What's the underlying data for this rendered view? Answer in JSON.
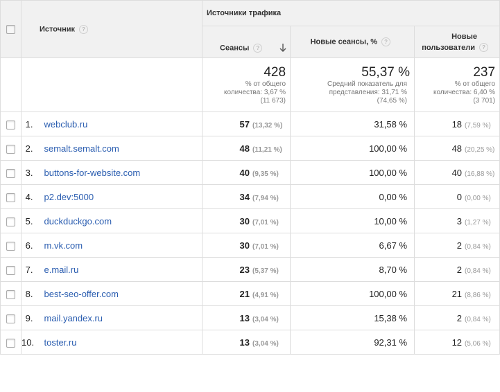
{
  "header": {
    "source_label": "Источник",
    "group_label": "Источники трафика",
    "sessions_label": "Сеансы",
    "new_sessions_label": "Новые сеансы, %",
    "new_users_label_line1": "Новые",
    "new_users_label_line2": "пользователи"
  },
  "summary": {
    "sessions": {
      "value": "428",
      "line1": "% от общего",
      "line2": "количества: 3,67 %",
      "line3": "(11 673)"
    },
    "new_sessions": {
      "value": "55,37 %",
      "line1": "Средний показатель для",
      "line2": "представления: 31,71 %",
      "line3": "(74,65 %)"
    },
    "new_users": {
      "value": "237",
      "line1": "% от общего",
      "line2": "количества: 6,40 %",
      "line3": "(3 701)"
    }
  },
  "rows": [
    {
      "idx": "1.",
      "source": "webclub.ru",
      "sessions": "57",
      "sessions_pct": "(13,32 %)",
      "new_sessions": "31,58 %",
      "new_users": "18",
      "new_users_pct": "(7,59 %)"
    },
    {
      "idx": "2.",
      "source": "semalt.semalt.com",
      "sessions": "48",
      "sessions_pct": "(11,21 %)",
      "new_sessions": "100,00 %",
      "new_users": "48",
      "new_users_pct": "(20,25 %)"
    },
    {
      "idx": "3.",
      "source": "buttons-for-website.com",
      "sessions": "40",
      "sessions_pct": "(9,35 %)",
      "new_sessions": "100,00 %",
      "new_users": "40",
      "new_users_pct": "(16,88 %)"
    },
    {
      "idx": "4.",
      "source": "p2.dev:5000",
      "sessions": "34",
      "sessions_pct": "(7,94 %)",
      "new_sessions": "0,00 %",
      "new_users": "0",
      "new_users_pct": "(0,00 %)"
    },
    {
      "idx": "5.",
      "source": "duckduckgo.com",
      "sessions": "30",
      "sessions_pct": "(7,01 %)",
      "new_sessions": "10,00 %",
      "new_users": "3",
      "new_users_pct": "(1,27 %)"
    },
    {
      "idx": "6.",
      "source": "m.vk.com",
      "sessions": "30",
      "sessions_pct": "(7,01 %)",
      "new_sessions": "6,67 %",
      "new_users": "2",
      "new_users_pct": "(0,84 %)"
    },
    {
      "idx": "7.",
      "source": "e.mail.ru",
      "sessions": "23",
      "sessions_pct": "(5,37 %)",
      "new_sessions": "8,70 %",
      "new_users": "2",
      "new_users_pct": "(0,84 %)"
    },
    {
      "idx": "8.",
      "source": "best-seo-offer.com",
      "sessions": "21",
      "sessions_pct": "(4,91 %)",
      "new_sessions": "100,00 %",
      "new_users": "21",
      "new_users_pct": "(8,86 %)"
    },
    {
      "idx": "9.",
      "source": "mail.yandex.ru",
      "sessions": "13",
      "sessions_pct": "(3,04 %)",
      "new_sessions": "15,38 %",
      "new_users": "2",
      "new_users_pct": "(0,84 %)"
    },
    {
      "idx": "10.",
      "source": "toster.ru",
      "sessions": "13",
      "sessions_pct": "(3,04 %)",
      "new_sessions": "92,31 %",
      "new_users": "12",
      "new_users_pct": "(5,06 %)"
    }
  ]
}
